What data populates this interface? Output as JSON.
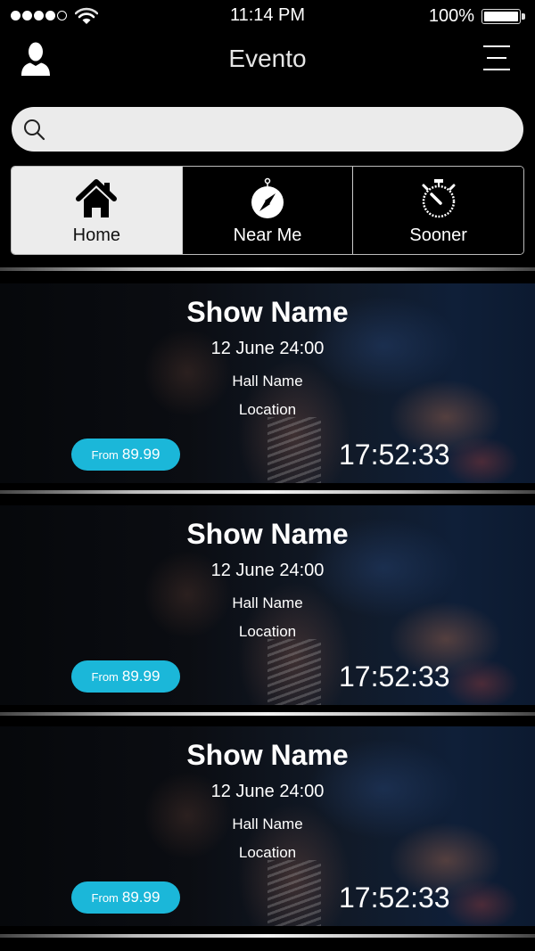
{
  "status_bar": {
    "signal_bars_filled": 4,
    "signal_bars_total": 5,
    "time": "11:14 PM",
    "battery_percent": "100%"
  },
  "header": {
    "title": "Evento",
    "left_icon": "profile-icon",
    "right_icon": "menu-icon"
  },
  "search": {
    "value": "",
    "placeholder": ""
  },
  "tabs": [
    {
      "label": "Home",
      "icon": "home-icon",
      "active": true
    },
    {
      "label": "Near Me",
      "icon": "compass-icon",
      "active": false
    },
    {
      "label": "Sooner",
      "icon": "stopwatch-icon",
      "active": false
    }
  ],
  "colors": {
    "accent": "#1bb7d9",
    "background": "#000000",
    "active_tab": "#ececec"
  },
  "events": [
    {
      "title": "Show Name",
      "date": "12 June 24:00",
      "hall": "Hall Name",
      "location": "Location",
      "price_prefix": "From",
      "price": "89.99",
      "countdown": "17:52:33"
    },
    {
      "title": "Show Name",
      "date": "12 June 24:00",
      "hall": "Hall Name",
      "location": "Location",
      "price_prefix": "From",
      "price": "89.99",
      "countdown": "17:52:33"
    },
    {
      "title": "Show Name",
      "date": "12 June 24:00",
      "hall": "Hall Name",
      "location": "Location",
      "price_prefix": "From",
      "price": "89.99",
      "countdown": "17:52:33"
    }
  ]
}
